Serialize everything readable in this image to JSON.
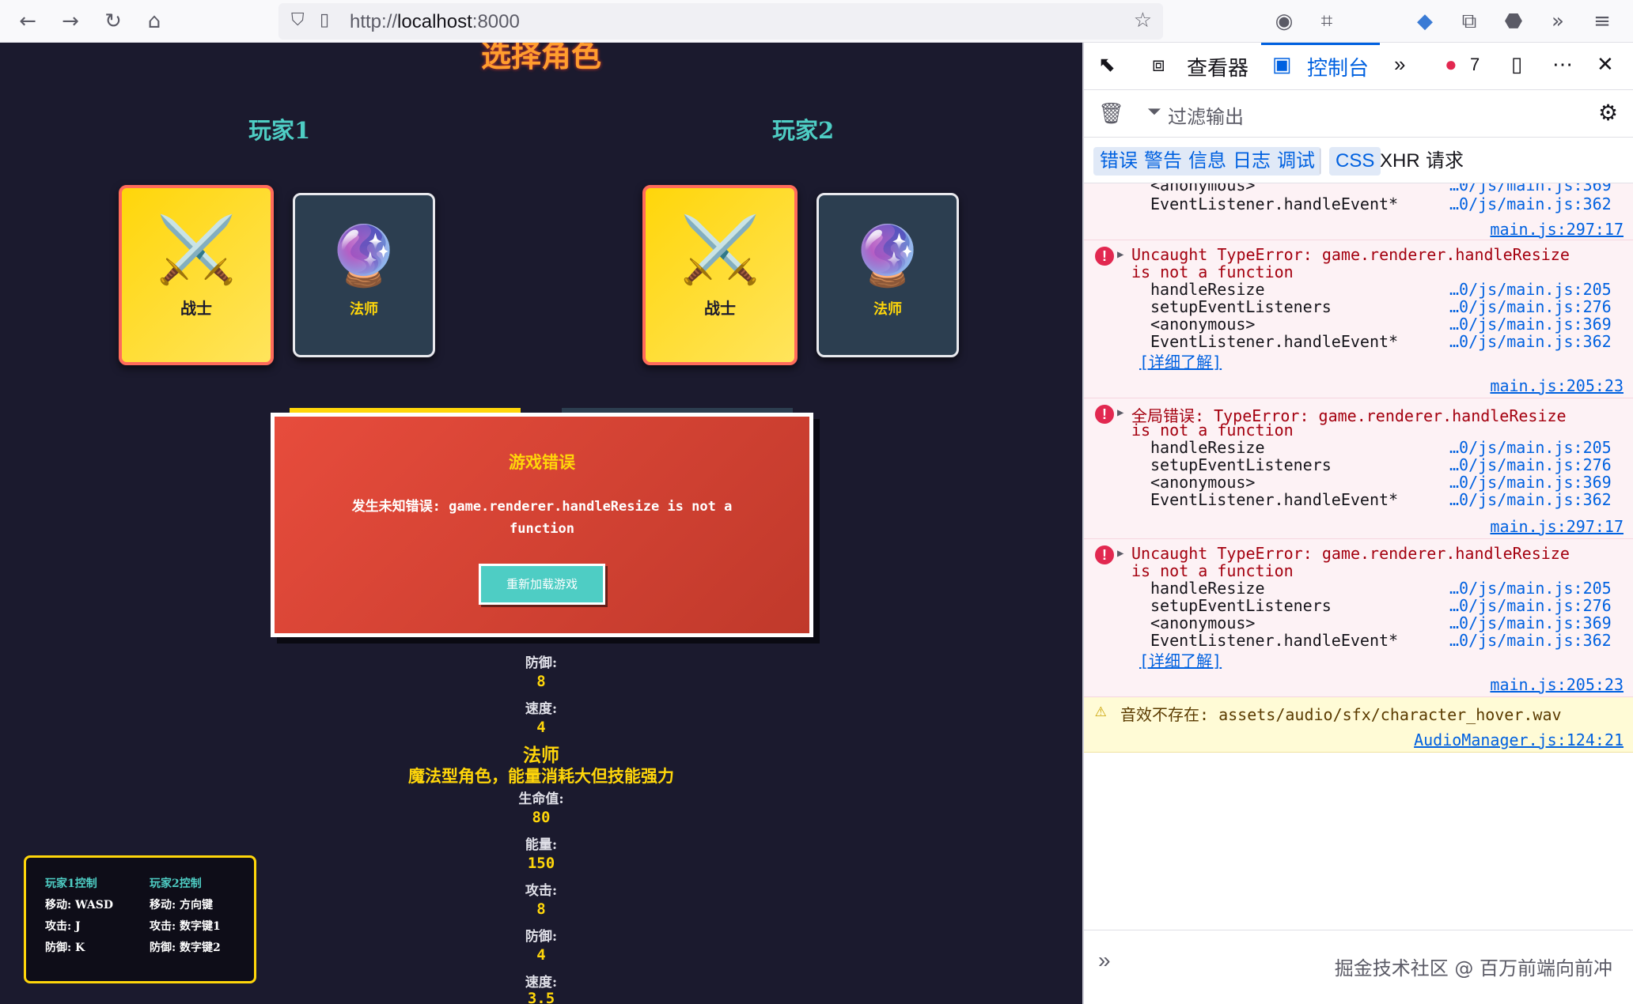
{
  "browser": {
    "url_prefix": "http://",
    "url_host": "localhost",
    "url_port": ":8000"
  },
  "game": {
    "title": "选择角色",
    "player1_label": "玩家1",
    "player2_label": "玩家2",
    "cards": {
      "warrior": {
        "name": "战士",
        "icon": "⚔️"
      },
      "mage": {
        "name": "法师",
        "icon": "🔮"
      }
    },
    "error_modal": {
      "title": "游戏错误",
      "message": "发生未知错误: game.renderer.handleResize is not a function",
      "reload_label": "重新加载游戏"
    },
    "stats_top": {
      "defense_label": "防御:",
      "defense_value": "8",
      "speed_label": "速度:",
      "speed_value": "4"
    },
    "mage_section": {
      "name": "法师",
      "description": "魔法型角色，能量消耗大但技能强力",
      "hp_label": "生命值:",
      "hp_value": "80",
      "energy_label": "能量:",
      "energy_value": "150",
      "attack_label": "攻击:",
      "attack_value": "8",
      "defense_label": "防御:",
      "defense_value": "4",
      "speed_label": "速度:",
      "speed_value": "3.5"
    },
    "controls": {
      "p1_header": "玩家1控制",
      "p1_move": "移动: WASD",
      "p1_attack": "攻击: J",
      "p1_defend": "防御: K",
      "p2_header": "玩家2控制",
      "p2_move": "移动: 方向键",
      "p2_attack": "攻击: 数字键1",
      "p2_defend": "防御: 数字键2"
    }
  },
  "devtools": {
    "tabs": {
      "inspector": "查看器",
      "console": "控制台",
      "error_count": "7"
    },
    "filter_placeholder": "过滤输出",
    "categories": [
      "错误",
      "警告",
      "信息",
      "日志",
      "调试",
      "CSS",
      "XHR",
      "请求"
    ],
    "top_partial": {
      "fn1": "<anonymous>",
      "loc1": "…0/js/main.js:369",
      "fn2": "EventListener.handleEvent*",
      "loc2": "…0/js/main.js:362",
      "src": "main.js:297:17"
    },
    "errors": [
      {
        "line1": "Uncaught TypeError: game.renderer.handleResize",
        "line2": "is not a function",
        "frames": [
          {
            "fn": "handleResize",
            "loc": "…0/js/main.js:205"
          },
          {
            "fn": "setupEventListeners",
            "loc": "…0/js/main.js:276"
          },
          {
            "fn": "<anonymous>",
            "loc": "…0/js/main.js:369"
          },
          {
            "fn": "EventListener.handleEvent*",
            "loc": "…0/js/main.js:362"
          }
        ],
        "learn_more": "[详细了解]",
        "src": "main.js:205:23"
      },
      {
        "line1": "全局错误: TypeError: game.renderer.handleResize",
        "line2": "is not a function",
        "frames": [
          {
            "fn": "handleResize",
            "loc": "…0/js/main.js:205"
          },
          {
            "fn": "setupEventListeners",
            "loc": "…0/js/main.js:276"
          },
          {
            "fn": "<anonymous>",
            "loc": "…0/js/main.js:369"
          },
          {
            "fn": "EventListener.handleEvent*",
            "loc": "…0/js/main.js:362"
          }
        ],
        "learn_more": "",
        "src": "main.js:297:17"
      },
      {
        "line1": "Uncaught TypeError: game.renderer.handleResize",
        "line2": "is not a function",
        "frames": [
          {
            "fn": "handleResize",
            "loc": "…0/js/main.js:205"
          },
          {
            "fn": "setupEventListeners",
            "loc": "…0/js/main.js:276"
          },
          {
            "fn": "<anonymous>",
            "loc": "…0/js/main.js:369"
          },
          {
            "fn": "EventListener.handleEvent*",
            "loc": "…0/js/main.js:362"
          }
        ],
        "learn_more": "[详细了解]",
        "src": "main.js:205:23"
      }
    ],
    "warning": {
      "text": "音效不存在: assets/audio/sfx/character_hover.wav",
      "src": "AudioManager.js:124:21"
    },
    "watermark": "掘金技术社区 @ 百万前端向前冲"
  }
}
